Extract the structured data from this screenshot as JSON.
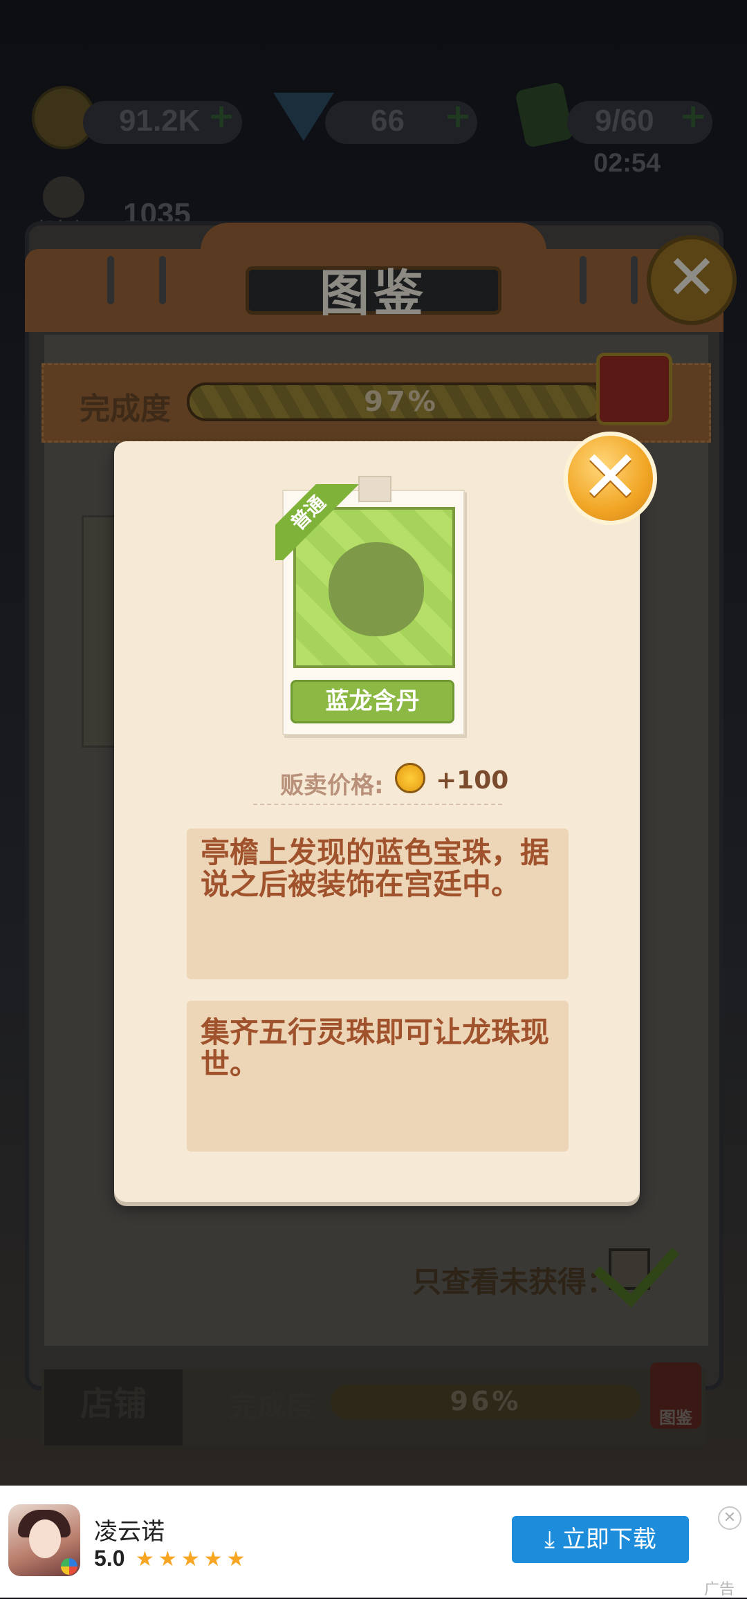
{
  "hud": {
    "coins": "91.2K",
    "gems": "66",
    "energy": "9/60",
    "energy_timer": "02:54",
    "fame_label": "知名度",
    "fame_value": "1035",
    "plus": "+"
  },
  "collection_book": {
    "title": "图鉴",
    "completion_label": "完成度",
    "completion_value": "97%",
    "completion_fraction": 0.97,
    "filter_label": "只查看未获得：",
    "filter_checked": true,
    "secondary_tab_label": "店铺",
    "secondary_completion_label": "完成度",
    "secondary_completion_value": "96%",
    "secondary_completion_fraction": 0.96,
    "secondary_icon_label": "图鉴"
  },
  "item_card": {
    "rarity": "普通",
    "name": "蓝龙含丹",
    "price_label": "贩卖价格:",
    "price_value": "+100",
    "description_1": "亭檐上发现的蓝色宝珠，据说之后被装饰在宫廷中。",
    "description_2": "集齐五行灵珠即可让龙珠现世。",
    "close_symbol": "✕"
  },
  "ad": {
    "app_name": "凌云诺",
    "rating": "5.0",
    "stars": "★★★★★",
    "download_label": "立即下载",
    "close_symbol": "✕",
    "tag": "广告"
  },
  "colors": {
    "item_green": "#8cb844",
    "desc_text": "#a0522d",
    "ad_button": "#1d8ddb",
    "card_bg": "#f6ead6"
  }
}
